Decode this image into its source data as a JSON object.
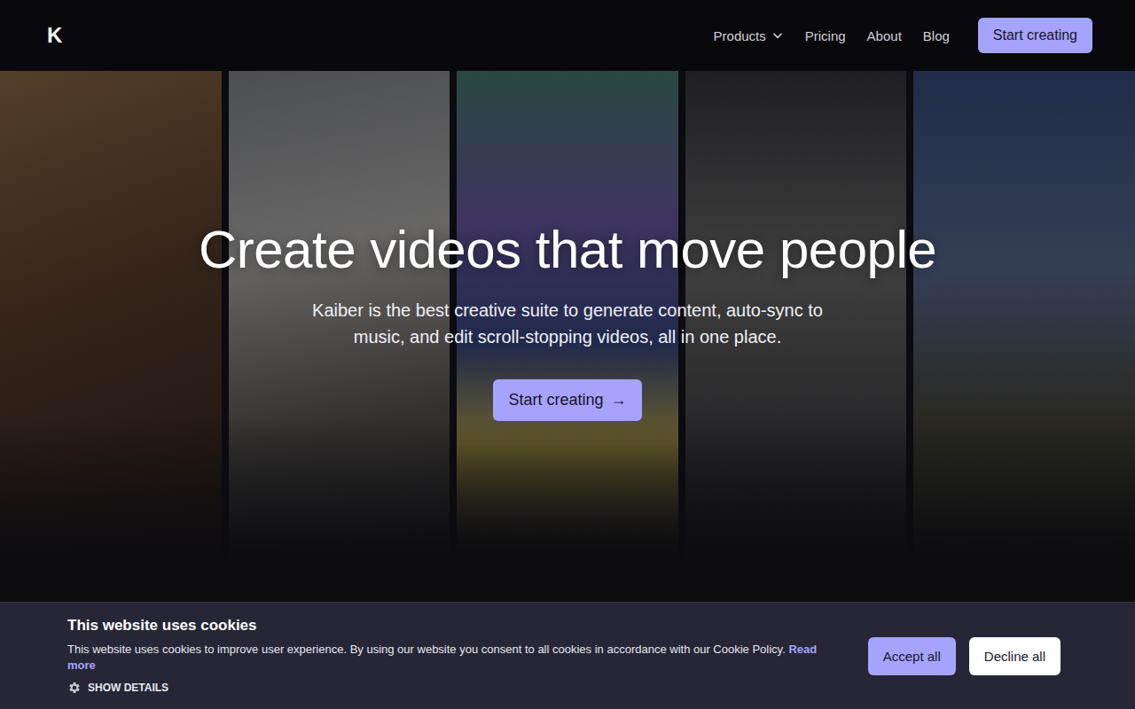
{
  "nav": {
    "logo": "K",
    "links": [
      {
        "label": "Products",
        "dropdown": true
      },
      {
        "label": "Pricing",
        "dropdown": false
      },
      {
        "label": "About",
        "dropdown": false
      },
      {
        "label": "Blog",
        "dropdown": false
      }
    ],
    "cta": "Start creating"
  },
  "hero": {
    "title": "Create videos that move people",
    "subtitle": "Kaiber is the best creative suite to generate content, auto-sync to music, and edit scroll-stopping videos, all in one place.",
    "cta": "Start creating",
    "cta_arrow": "→"
  },
  "cookie_banner": {
    "title": "This website uses cookies",
    "text": "This website uses cookies to improve user experience. By using our website you consent to all cookies in accordance with our Cookie Policy.",
    "link": "Read more",
    "details": "SHOW DETAILS",
    "buttons": [
      {
        "label": "Accept all",
        "primary": true
      },
      {
        "label": "Decline all",
        "primary": false
      }
    ]
  }
}
